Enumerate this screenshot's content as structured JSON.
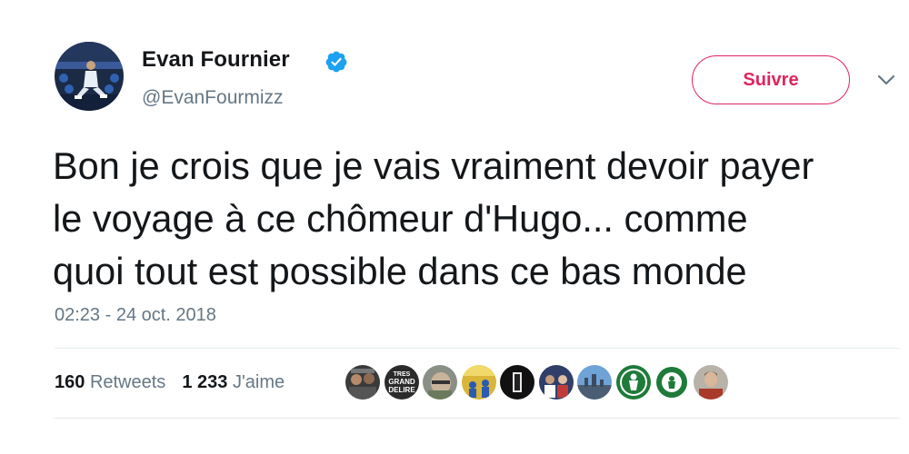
{
  "author": {
    "name": "Evan Fournier",
    "handle": "@EvanFourmizz",
    "verified": true
  },
  "follow_button": {
    "label": "Suivre",
    "color": "#e0245e"
  },
  "tweet": {
    "lines": [
      "Bon je crois que je vais vraiment devoir payer",
      "le voyage à ce chômeur d'Hugo... comme",
      "quoi tout est possible dans ce bas monde"
    ],
    "timestamp": "02:23 - 24 oct. 2018"
  },
  "stats": {
    "retweets_count": "160",
    "retweets_label": "Retweets",
    "likes_count": "1 233",
    "likes_label": "J'aime"
  },
  "likers": [
    {
      "icon": "liker-avatar-1"
    },
    {
      "icon": "liker-avatar-2",
      "text_lines": [
        "TRES",
        "GRAND",
        "DELIRE"
      ]
    },
    {
      "icon": "liker-avatar-3"
    },
    {
      "icon": "liker-avatar-4"
    },
    {
      "icon": "liker-avatar-5"
    },
    {
      "icon": "liker-avatar-6"
    },
    {
      "icon": "liker-avatar-7"
    },
    {
      "icon": "liker-avatar-8-celtics"
    },
    {
      "icon": "liker-avatar-9-celtics"
    },
    {
      "icon": "liker-avatar-10"
    }
  ],
  "colors": {
    "text_primary": "#14171a",
    "text_secondary": "#657786",
    "verified_blue": "#1da1f2",
    "divider": "#e6ecf0",
    "celtics_green": "#1e7b3a"
  }
}
